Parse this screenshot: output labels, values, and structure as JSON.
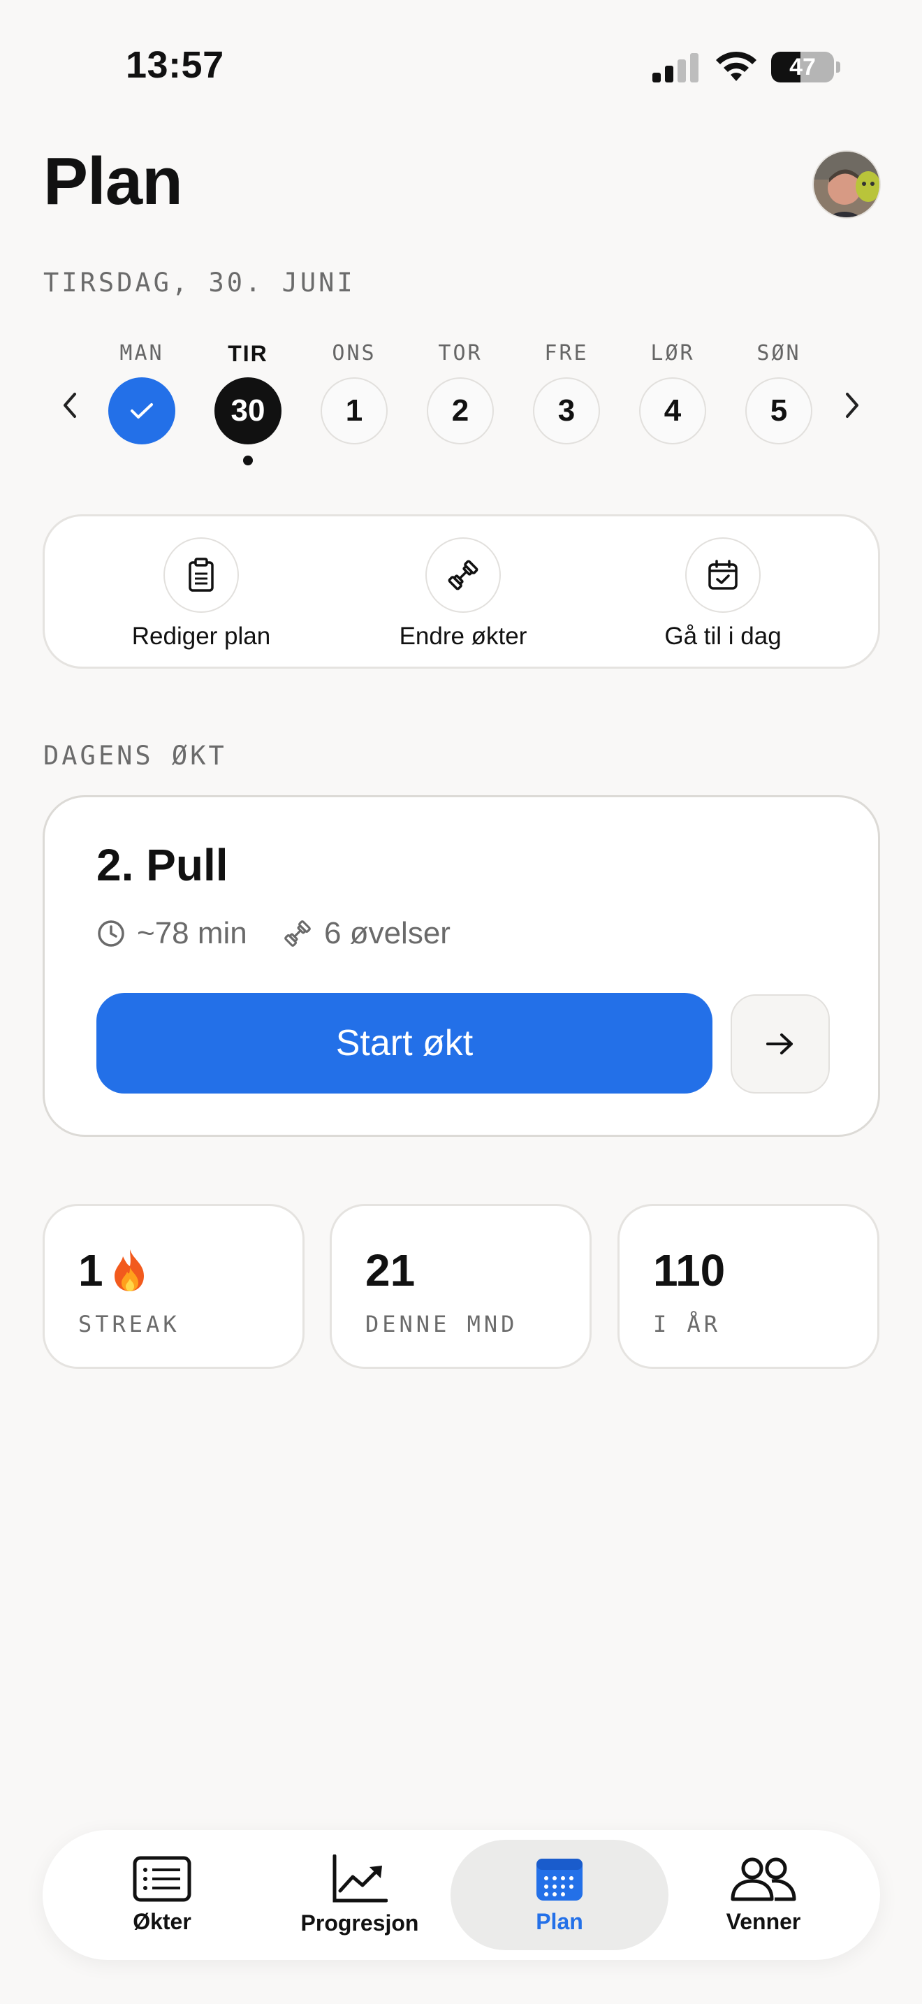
{
  "status_bar": {
    "time": "13:57",
    "battery": "47",
    "battery_level": 0.47
  },
  "header": {
    "title": "Plan"
  },
  "date_label": "TIRSDAG, 30. JUNI",
  "week": {
    "days": [
      {
        "name": "MAN",
        "number": "",
        "state": "done"
      },
      {
        "name": "TIR",
        "number": "30",
        "state": "today"
      },
      {
        "name": "ONS",
        "number": "1",
        "state": "upcoming"
      },
      {
        "name": "TOR",
        "number": "2",
        "state": "upcoming"
      },
      {
        "name": "FRE",
        "number": "3",
        "state": "upcoming"
      },
      {
        "name": "LØR",
        "number": "4",
        "state": "upcoming"
      },
      {
        "name": "SØN",
        "number": "5",
        "state": "upcoming"
      }
    ]
  },
  "actions": [
    {
      "label": "Rediger plan",
      "icon": "clipboard-icon"
    },
    {
      "label": "Endre økter",
      "icon": "dumbbell-icon"
    },
    {
      "label": "Gå til i dag",
      "icon": "calendar-check-icon"
    }
  ],
  "workout": {
    "section_label": "DAGENS ØKT",
    "title": "2. Pull",
    "duration": "~78 min",
    "exercises": "6 øvelser",
    "start_label": "Start økt"
  },
  "stats": [
    {
      "value": "1",
      "label": "STREAK",
      "icon": "fire-icon"
    },
    {
      "value": "21",
      "label": "DENNE MND"
    },
    {
      "value": "110",
      "label": "I ÅR"
    }
  ],
  "tabs": [
    {
      "label": "Økter",
      "icon": "list-icon",
      "active": false
    },
    {
      "label": "Progresjon",
      "icon": "chart-icon",
      "active": false
    },
    {
      "label": "Plan",
      "icon": "calendar-icon",
      "active": true
    },
    {
      "label": "Venner",
      "icon": "friends-icon",
      "active": false
    }
  ],
  "colors": {
    "accent": "#2370e8",
    "background": "#f9f8f7"
  }
}
